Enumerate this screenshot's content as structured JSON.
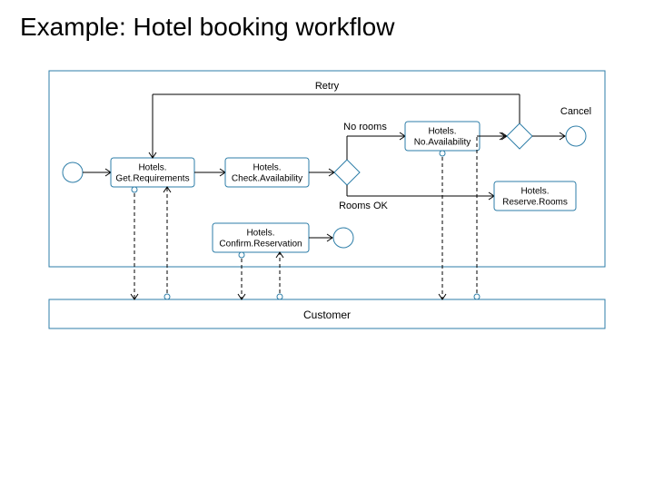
{
  "title": "Example: Hotel booking workflow",
  "lanes": {
    "customer": "Customer"
  },
  "edges": {
    "retry": "Retry",
    "norooms": "No rooms",
    "roomsok": "Rooms OK",
    "cancel": "Cancel"
  },
  "activities": {
    "getreq1": "Hotels.",
    "getreq2": "Get.Requirements",
    "check1": "Hotels.",
    "check2": "Check.Availability",
    "noavail1": "Hotels.",
    "noavail2": "No.Availability",
    "reserve1": "Hotels.",
    "reserve2": "Reserve.Rooms",
    "confirm1": "Hotels.",
    "confirm2": "Confirm.Reservation"
  }
}
